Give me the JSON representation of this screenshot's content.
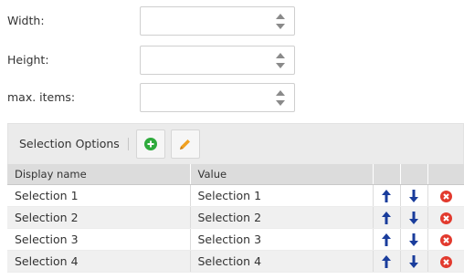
{
  "form": {
    "width": {
      "label": "Width:",
      "value": ""
    },
    "height": {
      "label": "Height:",
      "value": ""
    },
    "max_items": {
      "label": "max. items:",
      "value": ""
    }
  },
  "selection_options": {
    "title": "Selection Options",
    "add_icon": "plus-circle-icon",
    "edit_icon": "pencil-icon",
    "colors": {
      "add": "#2eaa3c",
      "edit": "#f0a020",
      "arrow": "#1a3d9c",
      "delete": "#e23a2e"
    },
    "columns": [
      "Display name",
      "Value",
      "",
      "",
      ""
    ],
    "rows": [
      {
        "display_name": "Selection 1",
        "value": "Selection 1"
      },
      {
        "display_name": "Selection 2",
        "value": "Selection 2"
      },
      {
        "display_name": "Selection 3",
        "value": "Selection 3"
      },
      {
        "display_name": "Selection 4",
        "value": "Selection 4"
      }
    ]
  }
}
